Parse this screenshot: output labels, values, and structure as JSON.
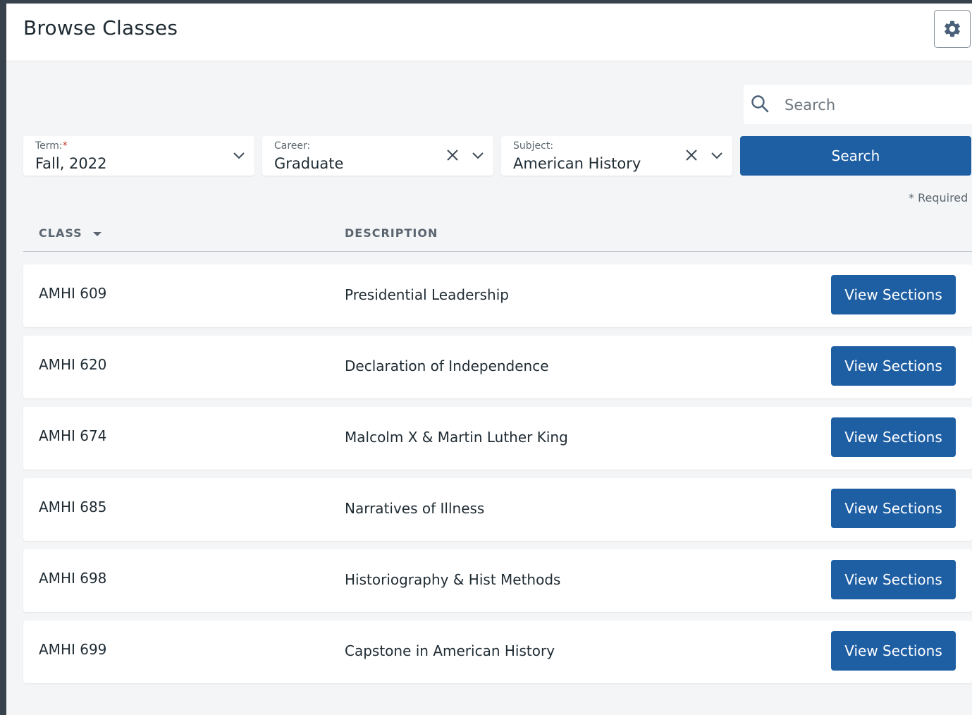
{
  "header": {
    "title": "Browse Classes",
    "settings_icon": "gear-icon"
  },
  "search": {
    "placeholder": "Search",
    "icon": "search-icon",
    "button_label": "Search"
  },
  "filters": {
    "term": {
      "label": "Term:",
      "required_mark": "*",
      "value": "Fall, 2022"
    },
    "career": {
      "label": "Career:",
      "value": "Graduate"
    },
    "subject": {
      "label": "Subject:",
      "value": "American History"
    }
  },
  "required_note": "* Required",
  "table": {
    "columns": {
      "class": "CLASS",
      "description": "DESCRIPTION"
    },
    "sort_icon": "caret-down-icon",
    "rows": [
      {
        "class": "AMHI 609",
        "description": "Presidential Leadership",
        "action": "View Sections"
      },
      {
        "class": "AMHI 620",
        "description": "Declaration of Independence",
        "action": "View Sections"
      },
      {
        "class": "AMHI 674",
        "description": "Malcolm X & Martin Luther King",
        "action": "View Sections"
      },
      {
        "class": "AMHI 685",
        "description": "Narratives of Illness",
        "action": "View Sections"
      },
      {
        "class": "AMHI 698",
        "description": "Historiography & Hist Methods",
        "action": "View Sections"
      },
      {
        "class": "AMHI 699",
        "description": "Capstone in American History",
        "action": "View Sections"
      }
    ]
  },
  "colors": {
    "primary": "#1e5ea3",
    "frame": "#37424c",
    "background": "#f4f5f7",
    "required": "#c0392b"
  }
}
